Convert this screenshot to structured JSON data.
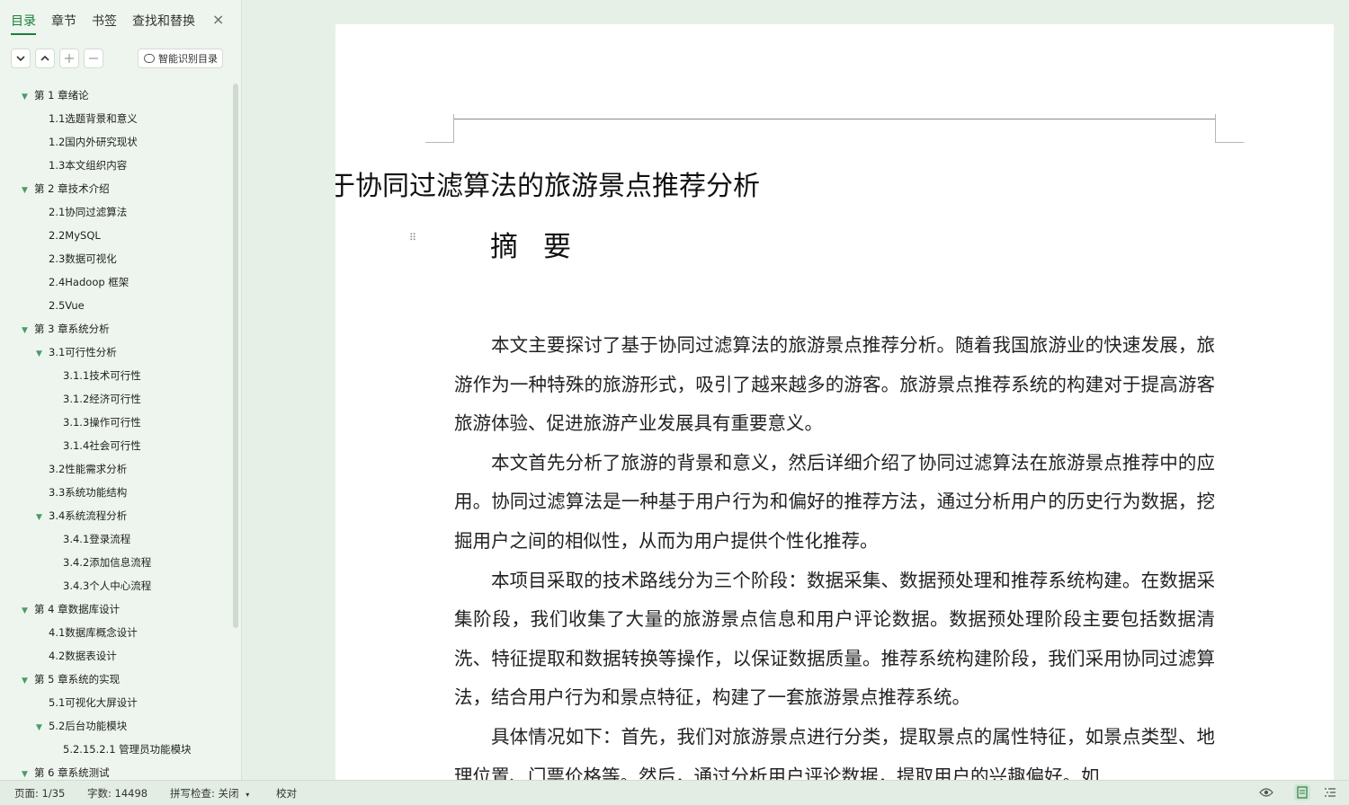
{
  "sidebar": {
    "tabs": [
      "目录",
      "章节",
      "书签",
      "查找和替换"
    ],
    "close_icon": "×",
    "toolbar": {
      "collapse_icon": "chevron-down-icon",
      "expand_icon": "chevron-up-icon",
      "add_icon": "plus-icon",
      "remove_icon": "minus-icon",
      "smart_label": "智能识别目录"
    },
    "toc": [
      {
        "text": "第 1 章绪论",
        "level": 0,
        "expanded": true
      },
      {
        "text": "1.1选题背景和意义",
        "level": 1
      },
      {
        "text": "1.2国内外研究现状",
        "level": 1
      },
      {
        "text": "1.3本文组织内容",
        "level": 1
      },
      {
        "text": "第 2 章技术介绍",
        "level": 0,
        "expanded": true
      },
      {
        "text": "2.1协同过滤算法",
        "level": 1
      },
      {
        "text": "2.2MySQL",
        "level": 1
      },
      {
        "text": "2.3数据可视化",
        "level": 1
      },
      {
        "text": "2.4Hadoop 框架",
        "level": 1
      },
      {
        "text": "2.5Vue",
        "level": 1
      },
      {
        "text": "第 3 章系统分析",
        "level": 0,
        "expanded": true
      },
      {
        "text": "3.1可行性分析",
        "level": 1,
        "expanded": true
      },
      {
        "text": "3.1.1技术可行性",
        "level": 2
      },
      {
        "text": "3.1.2经济可行性",
        "level": 2
      },
      {
        "text": "3.1.3操作可行性",
        "level": 2
      },
      {
        "text": "3.1.4社会可行性",
        "level": 2
      },
      {
        "text": "3.2性能需求分析",
        "level": 1
      },
      {
        "text": "3.3系统功能结构",
        "level": 1
      },
      {
        "text": "3.4系统流程分析",
        "level": 1,
        "expanded": true
      },
      {
        "text": "3.4.1登录流程",
        "level": 2
      },
      {
        "text": "3.4.2添加信息流程",
        "level": 2
      },
      {
        "text": "3.4.3个人中心流程",
        "level": 2
      },
      {
        "text": "第 4 章数据库设计",
        "level": 0,
        "expanded": true
      },
      {
        "text": "4.1数据库概念设计",
        "level": 1
      },
      {
        "text": "4.2数据表设计",
        "level": 1
      },
      {
        "text": "第 5 章系统的实现",
        "level": 0,
        "expanded": true
      },
      {
        "text": "5.1可视化大屏设计",
        "level": 1
      },
      {
        "text": "5.2后台功能模块",
        "level": 1,
        "expanded": true
      },
      {
        "text": "5.2.15.2.1 管理员功能模块",
        "level": 2
      },
      {
        "text": "第 6 章系统测试",
        "level": 0,
        "expanded": true
      }
    ]
  },
  "document": {
    "title": "基于协同过滤算法的旅游景点推荐分析",
    "abstract_heading": "摘要",
    "paragraphs": [
      "本文主要探讨了基于协同过滤算法的旅游景点推荐分析。随着我国旅游业的快速发展，旅游作为一种特殊的旅游形式，吸引了越来越多的游客。旅游景点推荐系统的构建对于提高游客旅游体验、促进旅游产业发展具有重要意义。",
      "本文首先分析了旅游的背景和意义，然后详细介绍了协同过滤算法在旅游景点推荐中的应用。协同过滤算法是一种基于用户行为和偏好的推荐方法，通过分析用户的历史行为数据，挖掘用户之间的相似性，从而为用户提供个性化推荐。",
      "本项目采取的技术路线分为三个阶段：数据采集、数据预处理和推荐系统构建。在数据采集阶段，我们收集了大量的旅游景点信息和用户评论数据。数据预处理阶段主要包括数据清洗、特征提取和数据转换等操作，以保证数据质量。推荐系统构建阶段，我们采用协同过滤算法，结合用户行为和景点特征，构建了一套旅游景点推荐系统。",
      "具体情况如下：首先，我们对旅游景点进行分类，提取景点的属性特征，如景点类型、地理位置、门票价格等。然后，通过分析用户评论数据，提取用户的兴趣偏好。如"
    ]
  },
  "statusbar": {
    "page": "页面: 1/35",
    "words": "字数: 14498",
    "spell": "拼写检查: 关闭",
    "proof": "校对"
  }
}
